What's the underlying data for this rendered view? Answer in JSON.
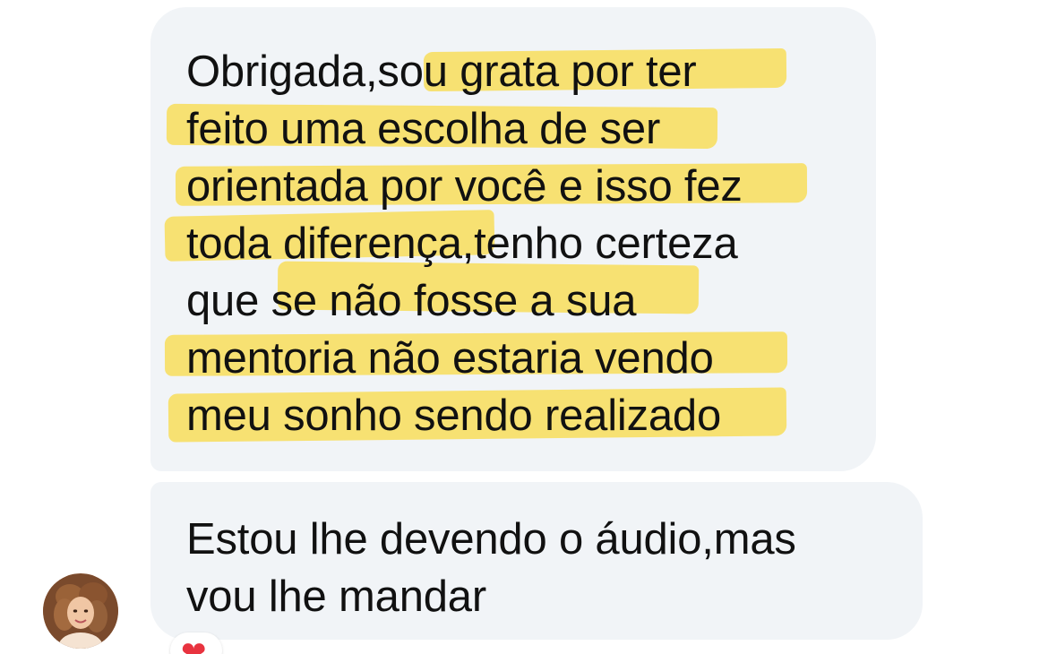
{
  "messages": [
    {
      "lines": [
        "Obrigada,sou grata por ter",
        "feito uma escolha de ser",
        "orientada por você e isso fez",
        "toda diferença,tenho certeza",
        "que se não fosse a sua",
        "mentoria não estaria vendo",
        "meu sonho sendo realizado"
      ]
    },
    {
      "lines": [
        "Estou lhe devendo o áudio,mas",
        "vou lhe mandar"
      ],
      "reaction": "heart-icon"
    }
  ],
  "colors": {
    "bubble_background": "#f1f4f7",
    "highlight": "#f7df63",
    "text": "#111111",
    "reaction_heart": "#e8333f"
  }
}
